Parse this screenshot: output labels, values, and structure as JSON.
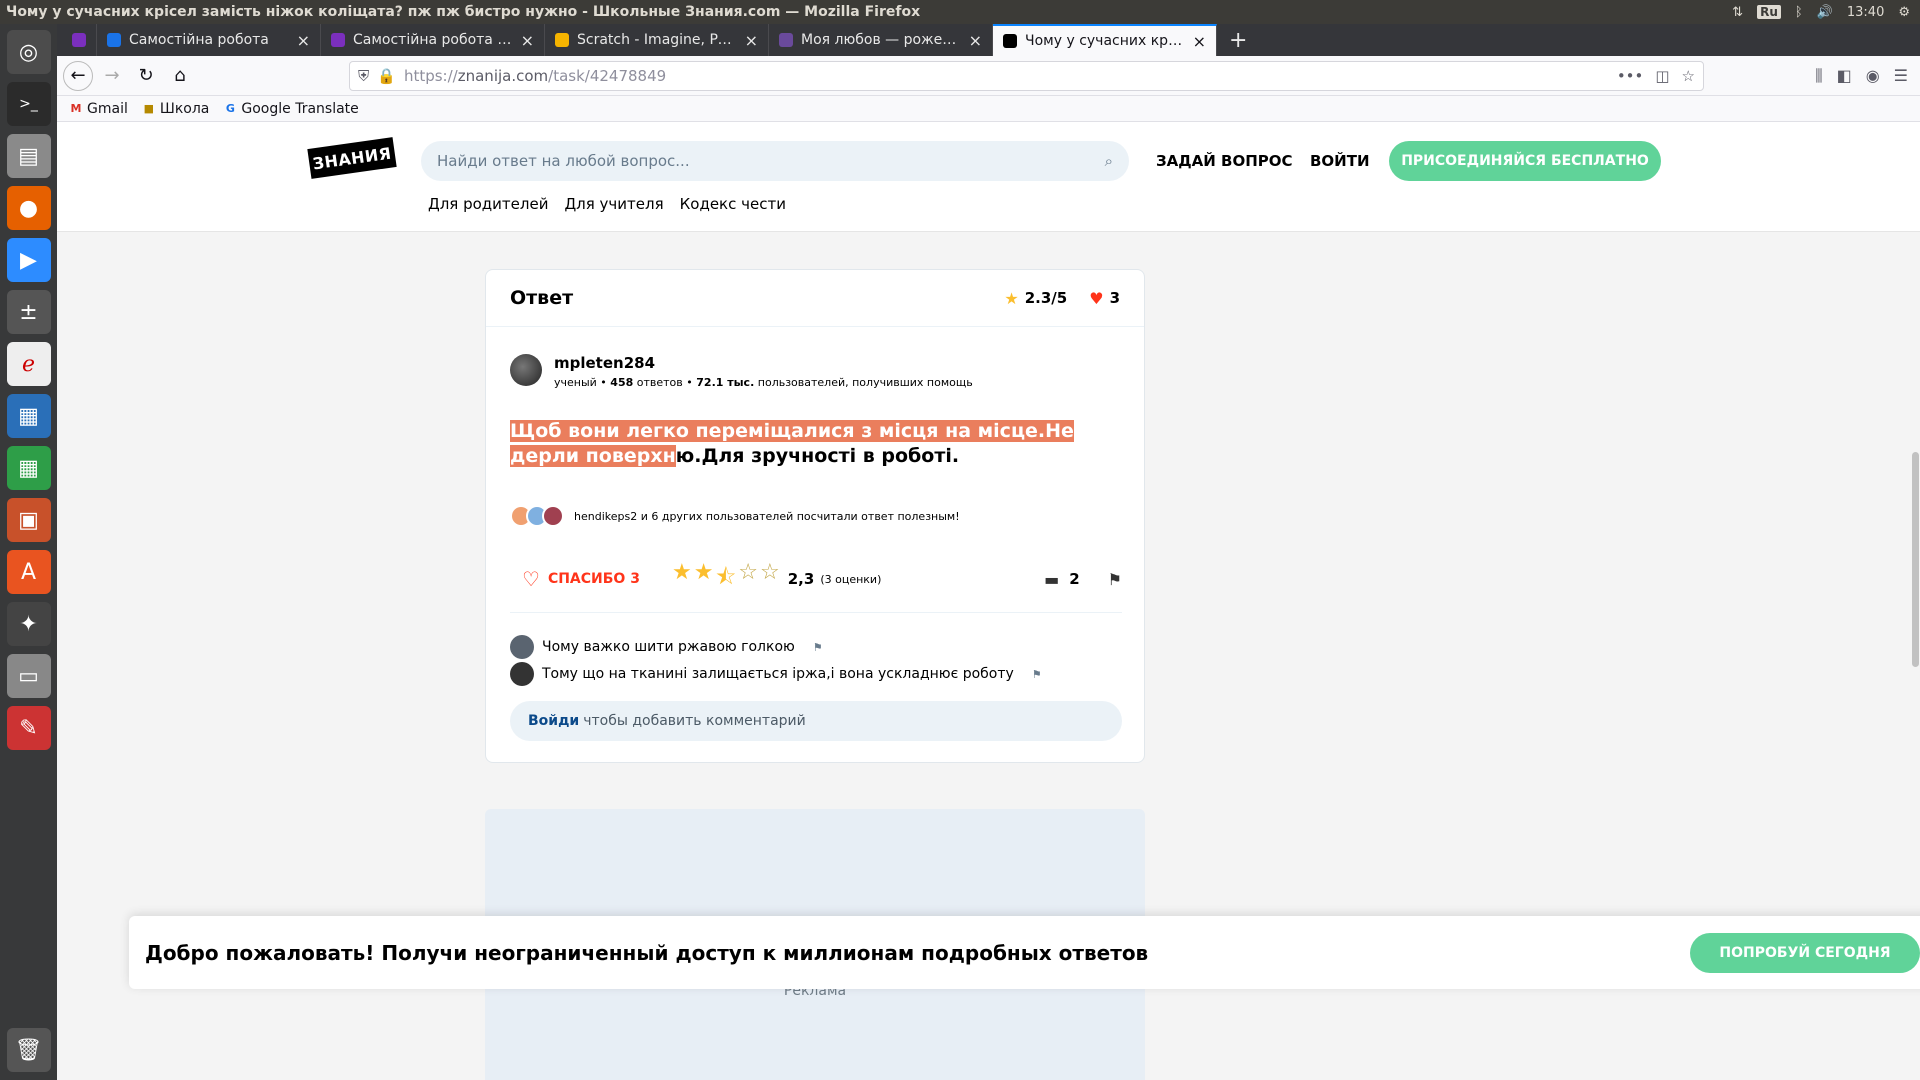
{
  "window_title": "Чому у сучасних крісел замість ніжок коліщата? пж пж бистро нужно - Школьные Знания.com — Mozilla Firefox",
  "tray": {
    "keyboard": "Ru",
    "time": "13:40"
  },
  "tabs": [
    {
      "label": "",
      "color": "#7b2fbe"
    },
    {
      "label": "Самостійна робота",
      "color": "#1a73e8"
    },
    {
      "label": "Самостійна робота з те",
      "color": "#7b2fbe"
    },
    {
      "label": "Scratch - Imagine, Progr",
      "color": "#f6b400"
    },
    {
      "label": "Моя любов — рожевий",
      "color": "#6a4a9c"
    },
    {
      "label": "Чому у сучасних крісел",
      "color": "#000000"
    }
  ],
  "url": {
    "scheme": "https://",
    "host": "znanija.com",
    "path": "/task/42478849"
  },
  "bookmarks": [
    {
      "label": "Gmail",
      "icon": "M",
      "color": "#d93025"
    },
    {
      "label": "Школа",
      "icon": "■",
      "color": "#b58900"
    },
    {
      "label": "Google Translate",
      "icon": "G",
      "color": "#1a73e8"
    }
  ],
  "site": {
    "logo": "ЗНАНИЯ",
    "search_placeholder": "Найди ответ на любой вопрос...",
    "ask": "ЗАДАЙ ВОПРОС",
    "login": "ВОЙТИ",
    "join": "ПРИСОЕДИНЯЙСЯ БЕСПЛАТНО",
    "subnav": [
      "Для родителей",
      "Для учителя",
      "Кодекс чести"
    ]
  },
  "answer": {
    "heading": "Ответ",
    "rating": "2.3/5",
    "hearts": "3",
    "author": "mpleten284",
    "rank": "ученый",
    "answers_count": "458",
    "answers_word": "ответов",
    "helped": "72.1 тыс.",
    "helped_text": "пользователей, получивших помощь",
    "text_highlighted": "Щоб вони легко переміщалися з місця на місце.Не дерли поверхн",
    "text_rest": "ю.Для зручності в роботі.",
    "thanked_text": "hendikeps2 и 6 других пользователей посчитали ответ полезным!",
    "thanks_label": "СПАСИБО 3",
    "rating_value": "2,3",
    "rating_count": "(3 оценки)",
    "stars_value": 2.3,
    "comments_count": "2",
    "comments": [
      {
        "text": "Чому важко шити ржавою голкою",
        "avatar_color": "#5a6470"
      },
      {
        "text": "Тому що на тканині залищається іржа,і вона ускладнює роботу",
        "avatar_color": "#333333"
      }
    ],
    "add_comment_link": "Войди",
    "add_comment_text": "чтобы добавить комментарий"
  },
  "ad_label": "Реклама",
  "banner": {
    "text": "Добро пожаловать! Получи неограниченный доступ к миллионам подробных ответов",
    "button": "ПОПРОБУЙ СЕГОДНЯ"
  }
}
